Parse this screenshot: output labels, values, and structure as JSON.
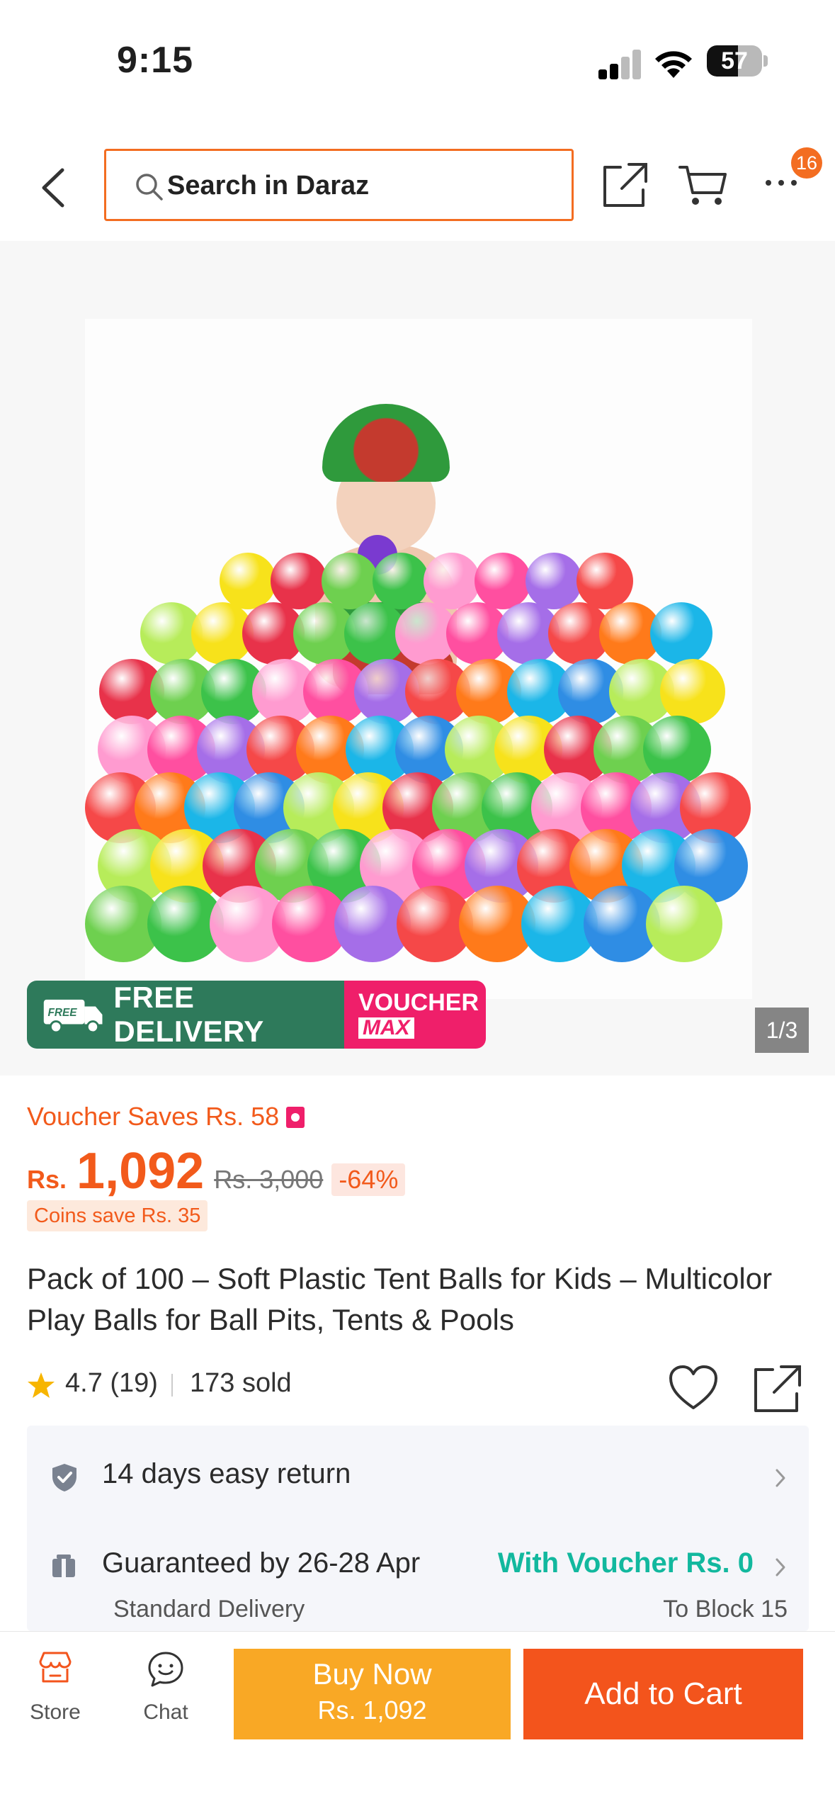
{
  "status_bar": {
    "time": "9:15",
    "battery": "57",
    "battery_level": 0.57
  },
  "header": {
    "search_placeholder": "Search in Daraz",
    "cart_badge": "16"
  },
  "gallery": {
    "promo_free_delivery": "FREE DELIVERY",
    "promo_truck_label": "FREE",
    "promo_voucher": "VOUCHER",
    "promo_max": "MAX",
    "counter": "1/3"
  },
  "pricing": {
    "voucher_saves": "Voucher Saves Rs. 58",
    "currency": "Rs.",
    "price": "1,092",
    "original_price": "Rs. 3,000",
    "discount": "-64%",
    "coins_save": "Coins save Rs. 35"
  },
  "product": {
    "title": "Pack of 100 – Soft Plastic Tent Balls for Kids – Multicolor Play Balls for Ball Pits, Tents & Pools",
    "rating": "4.7 (19)",
    "sold": "173 sold"
  },
  "services": {
    "return": "14 days easy return",
    "guaranteed": "Guaranteed by 26-28 Apr",
    "with_voucher": "With Voucher Rs. 0",
    "standard_delivery": "Standard Delivery",
    "to_location": "To Block 15"
  },
  "bottom_bar": {
    "store": "Store",
    "chat": "Chat",
    "buy_now": "Buy Now",
    "buy_now_price": "Rs. 1,092",
    "add_to_cart": "Add to Cart"
  },
  "colors": {
    "accent": "#f36d21",
    "price": "#f25a1b",
    "buy_now": "#f9a825",
    "add_to_cart": "#f3541c",
    "delivery_green": "#2e7a5b",
    "voucher_pink": "#ef1f6a",
    "with_voucher": "#12b89e"
  }
}
